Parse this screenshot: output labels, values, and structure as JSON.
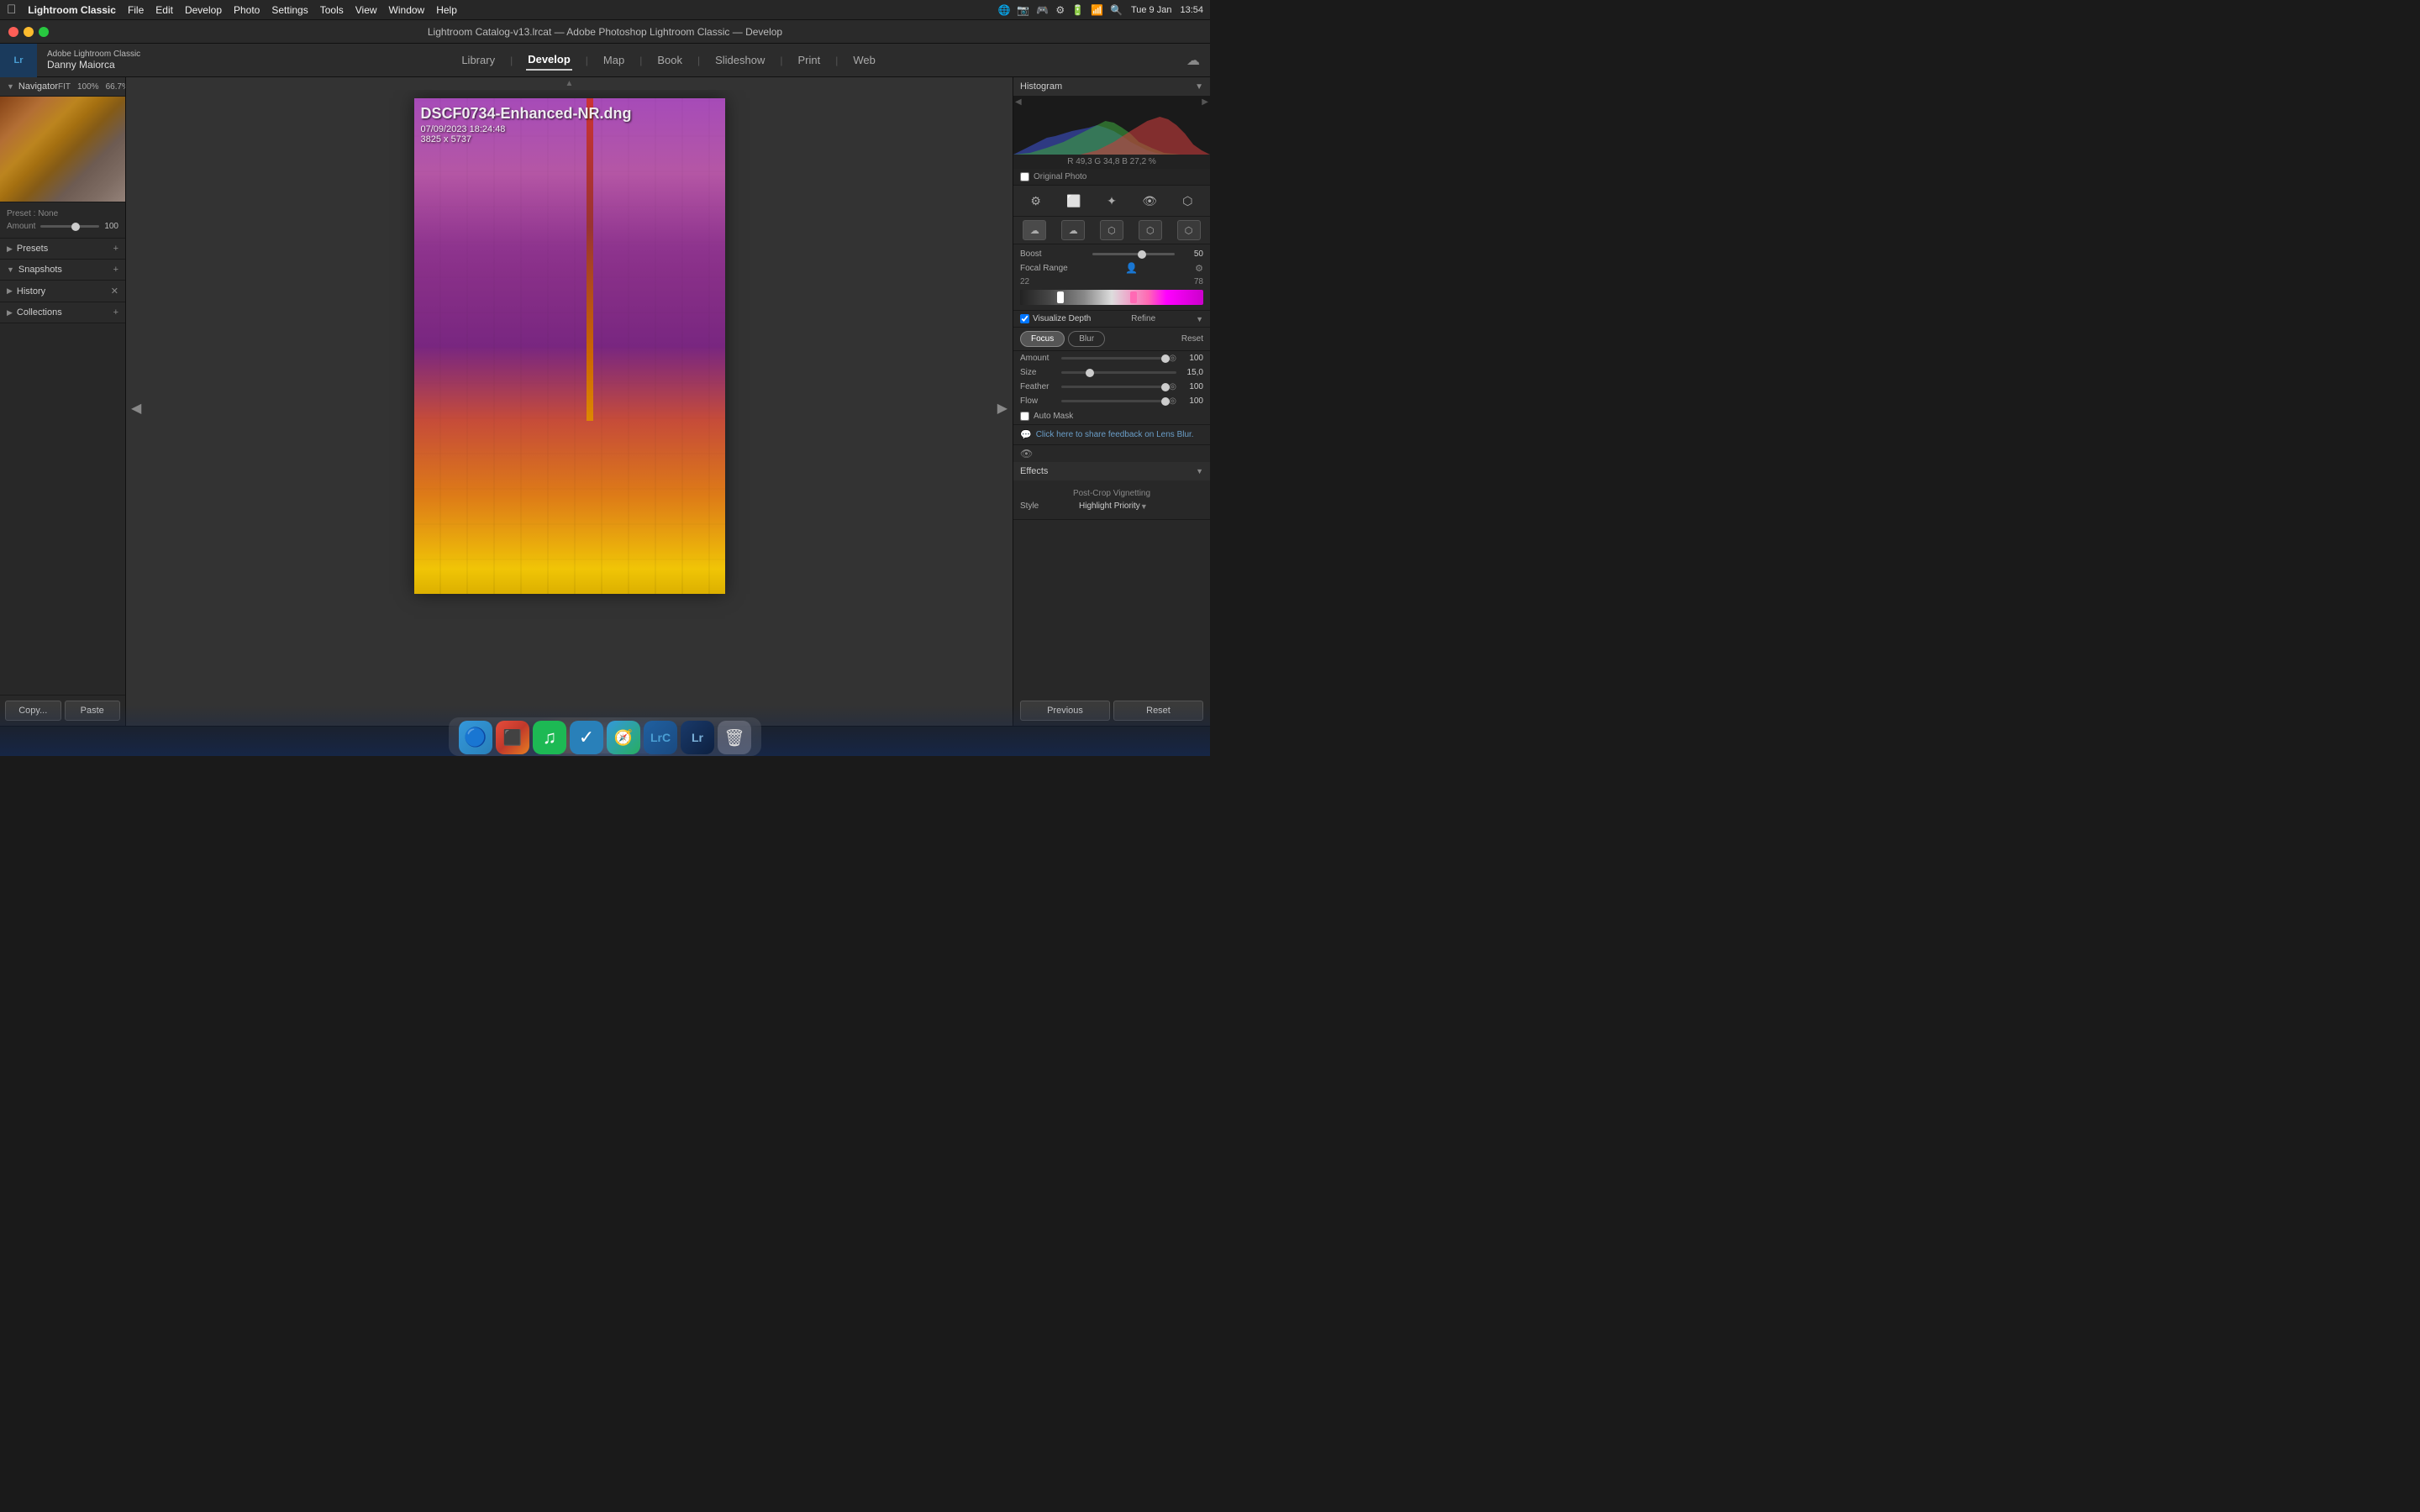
{
  "menubar": {
    "apple": "⌘",
    "items": [
      "Lightroom Classic",
      "File",
      "Edit",
      "Develop",
      "Photo",
      "Settings",
      "Tools",
      "View",
      "Window",
      "Help"
    ],
    "right_items": [
      "Tue 9 Jan",
      "13:54"
    ]
  },
  "titlebar": {
    "title": "Lightroom Catalog-v13.lrcat — Adobe Photoshop Lightroom Classic — Develop"
  },
  "appheader": {
    "app_name": "Adobe Lightroom Classic",
    "username": "Danny Maiorca",
    "lr_abbr": "Lr",
    "nav": [
      "Library",
      "Develop",
      "Map",
      "Book",
      "Slideshow",
      "Print",
      "Web"
    ],
    "active_nav": "Develop"
  },
  "left_panel": {
    "navigator": {
      "title": "Navigator",
      "fit_label": "FIT",
      "zoom1": "100%",
      "zoom2": "66.7%"
    },
    "preset": {
      "preset_label": "Preset : None",
      "amount_label": "Amount",
      "amount_value": "100"
    },
    "presets": {
      "title": "Presets",
      "add_icon": "+"
    },
    "snapshots": {
      "title": "Snapshots",
      "add_icon": "+"
    },
    "history": {
      "title": "History",
      "close_icon": "✕"
    },
    "collections": {
      "title": "Collections",
      "add_icon": "+"
    },
    "copy_btn": "Copy...",
    "paste_btn": "Paste"
  },
  "photo": {
    "filename": "DSCF0734-Enhanced-NR.dng",
    "datetime": "07/09/2023 18:24:48",
    "dimensions": "3825 x 5737"
  },
  "right_panel": {
    "histogram": {
      "title": "Histogram",
      "values": "R  49,3  G  34,8  B  27,2  %"
    },
    "original_photo_label": "Original Photo",
    "boost_label": "Boost",
    "boost_value": "50",
    "focal_range_label": "Focal Range",
    "focal_min": "22",
    "focal_max": "78",
    "visualize_depth_label": "Visualize Depth",
    "refine_label": "Refine",
    "focus_btn": "Focus",
    "blur_btn": "Blur",
    "reset_btn": "Reset",
    "amount_label": "Amount",
    "amount_value": "100",
    "size_label": "Size",
    "size_value": "15,0",
    "feather_label": "Feather",
    "feather_value": "100",
    "flow_label": "Flow",
    "flow_value": "100",
    "auto_mask_label": "Auto Mask",
    "feedback_text": "Click here to share feedback on Lens Blur.",
    "effects_title": "Effects",
    "post_crop_label": "Post-Crop Vignetting",
    "style_label": "Style",
    "style_value": "Highlight Priority",
    "previous_btn": "Previous",
    "reset_btn2": "Reset"
  },
  "dock": {
    "finder": "🔵",
    "launchpad": "🚀",
    "spotify": "♪",
    "tasks": "✓",
    "safari": "🧭",
    "lr_classic": "LrC",
    "lr": "Lr",
    "trash": "🗑"
  }
}
